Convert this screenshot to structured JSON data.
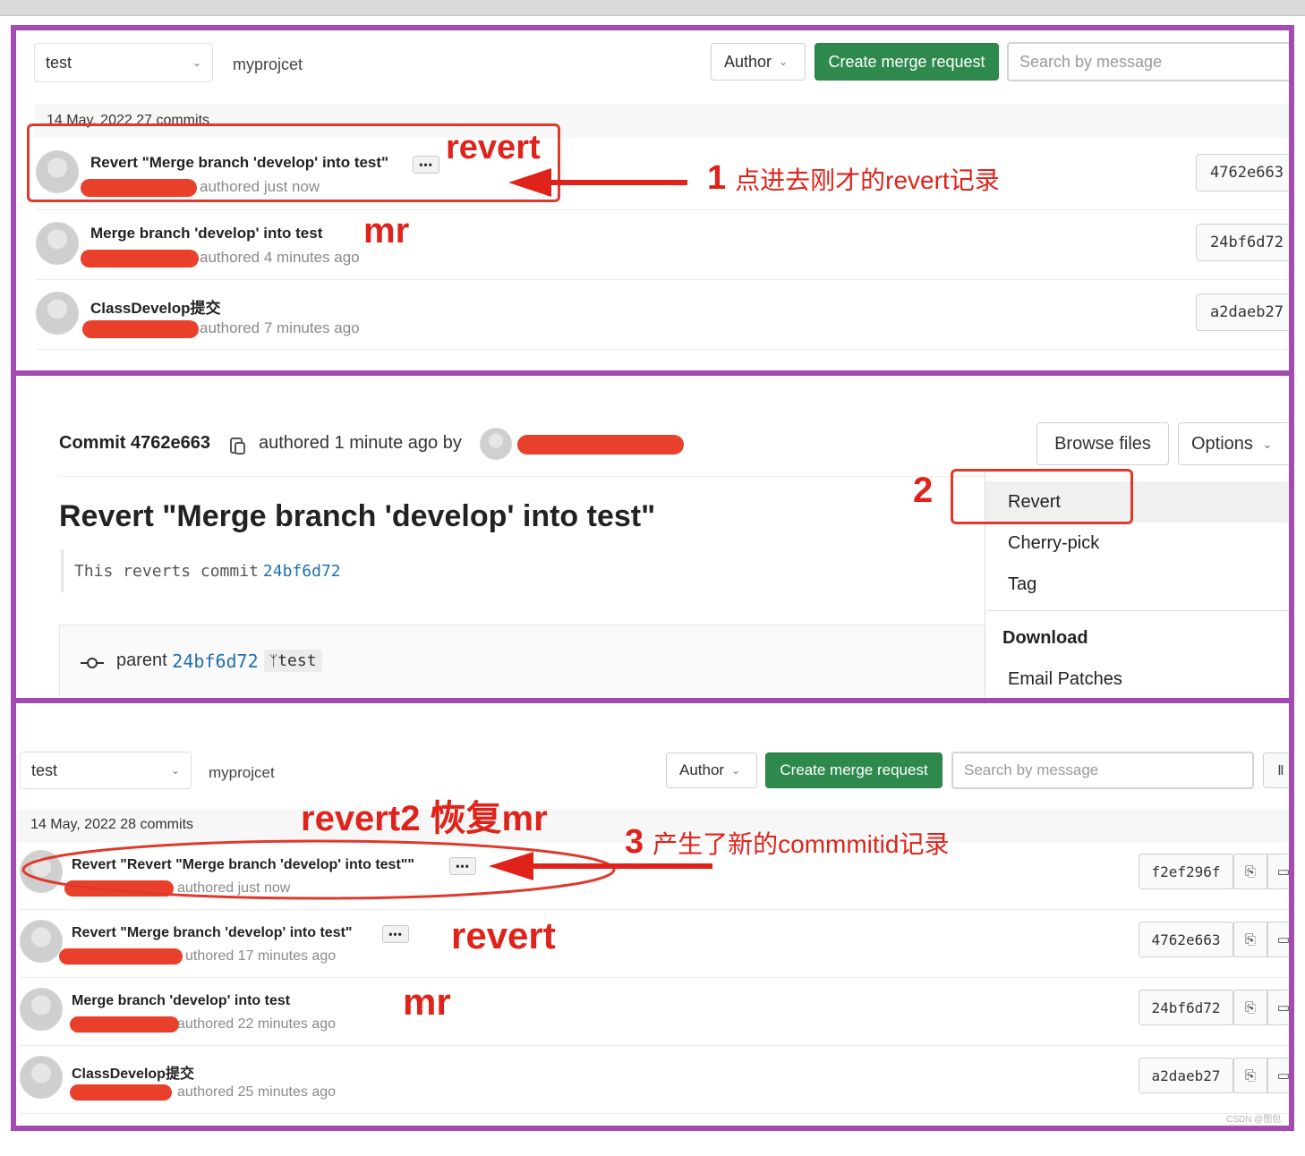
{
  "colors": {
    "panel_border": "#a24bb0",
    "annotation_red": "#e0231a",
    "green_button": "#2e8a4c",
    "link_blue": "#1f6fb2"
  },
  "panel1": {
    "branch_select": "test",
    "project": "myprojcet",
    "author_button": "Author",
    "create_mr_button": "Create merge request",
    "search_placeholder": "Search by message",
    "date_header": "14 May, 2022 27 commits",
    "commits": [
      {
        "title": "Revert \"Merge branch 'develop' into test\"",
        "meta": "authored just now",
        "sha": "4762e663",
        "more": "•••"
      },
      {
        "title": "Merge branch 'develop' into test",
        "meta": "authored 4 minutes ago",
        "sha": "24bf6d72"
      },
      {
        "title": "ClassDevelop提交",
        "meta": "authored 7 minutes ago",
        "sha": "a2daeb27"
      }
    ],
    "annot_revert": "revert",
    "annot_mr": "mr",
    "note_num": "1",
    "note_text": "点进去刚才的revert记录"
  },
  "panel2": {
    "commit_label": "Commit 4762e663",
    "authored_by": "authored 1 minute ago by",
    "browse_files": "Browse files",
    "options": "Options",
    "heading": "Revert \"Merge branch 'develop' into test\"",
    "reverts_text": "This reverts commit",
    "reverts_sha": "24bf6d72",
    "parent_label": "parent",
    "parent_sha": "24bf6d72",
    "branch_tag": "test",
    "menu": {
      "revert": "Revert",
      "cherry_pick": "Cherry-pick",
      "tag": "Tag",
      "download_header": "Download",
      "email_patches": "Email Patches"
    },
    "note_num": "2"
  },
  "panel3": {
    "branch_select": "test",
    "project": "myprojcet",
    "author_button": "Author",
    "create_mr_button": "Create merge request",
    "search_placeholder": "Search by message",
    "date_header": "14 May, 2022 28 commits",
    "commits": [
      {
        "title": "Revert \"Revert \"Merge branch 'develop' into test\"\"",
        "meta": "authored just now",
        "sha": "f2ef296f",
        "more": "•••"
      },
      {
        "title": "Revert \"Merge branch 'develop' into test\"",
        "meta": "uthored 17 minutes ago",
        "sha": "4762e663",
        "more": "•••"
      },
      {
        "title": "Merge branch 'develop' into test",
        "meta": "authored 22 minutes ago",
        "sha": "24bf6d72"
      },
      {
        "title": "ClassDevelop提交",
        "meta": "authored 25 minutes ago",
        "sha": "a2daeb27"
      }
    ],
    "annot_revert2": "revert2 恢复mr",
    "annot_revert": "revert",
    "annot_mr": "mr",
    "note_num": "3",
    "note_text": "产生了新的commmitid记录",
    "watermark": "CSDN @图包君"
  }
}
